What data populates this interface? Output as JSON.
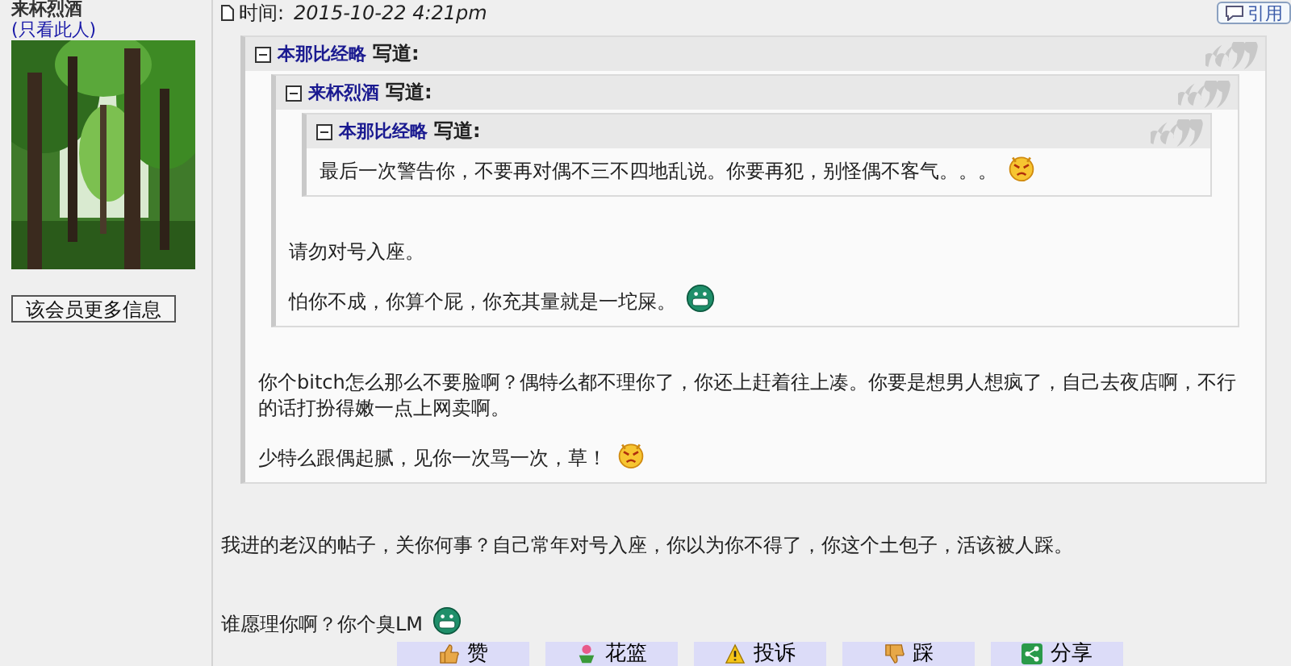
{
  "author": {
    "name": "来杯烈酒",
    "only_this_link": "(只看此人)",
    "more_info_button": "该会员更多信息"
  },
  "post": {
    "time_label": "时间:",
    "time": "2015-10-22 4:21pm",
    "quote_button": "引用",
    "quote": {
      "author": "本那比经略",
      "said": "写道:",
      "quote": {
        "author": "来杯烈酒",
        "said": "写道:",
        "quote": {
          "author": "本那比经略",
          "said": "写道:",
          "paragraphs": [
            {
              "text": "最后一次警告你，不要再对偶不三不四地乱说。你要再犯，别怪偶不客气。。。",
              "kind": "angry"
            }
          ]
        },
        "paragraphs": [
          {
            "text": "请勿对号入座。",
            "kind": "plain"
          },
          {
            "text": "怕你不成，你算个屁，你充其量就是一坨屎。",
            "kind": "grin"
          }
        ]
      },
      "paragraphs": [
        {
          "text": "你个bitch怎么那么不要脸啊？偶特么都不理你了，你还上赶着往上凑。你要是想男人想疯了，自己去夜店啊，不行的话打扮得嫩一点上网卖啊。",
          "kind": "plain"
        },
        {
          "text": "少特么跟偶起腻，见你一次骂一次，草！",
          "kind": "angry"
        }
      ]
    },
    "paragraphs": [
      {
        "text": "我进的老汉的帖子，关你何事？自己常年对号入座，你以为你不得了，你这个土包子，活该被人踩。",
        "kind": "plain"
      },
      {
        "text": "谁愿理你啊？你个臭LM",
        "kind": "grin"
      }
    ]
  },
  "actions": [
    {
      "label": "赞",
      "kind": "like"
    },
    {
      "label": "花篮",
      "kind": "flower"
    },
    {
      "label": "投诉",
      "kind": "report"
    },
    {
      "label": "踩",
      "kind": "dislike"
    },
    {
      "label": "分享",
      "kind": "share"
    }
  ]
}
